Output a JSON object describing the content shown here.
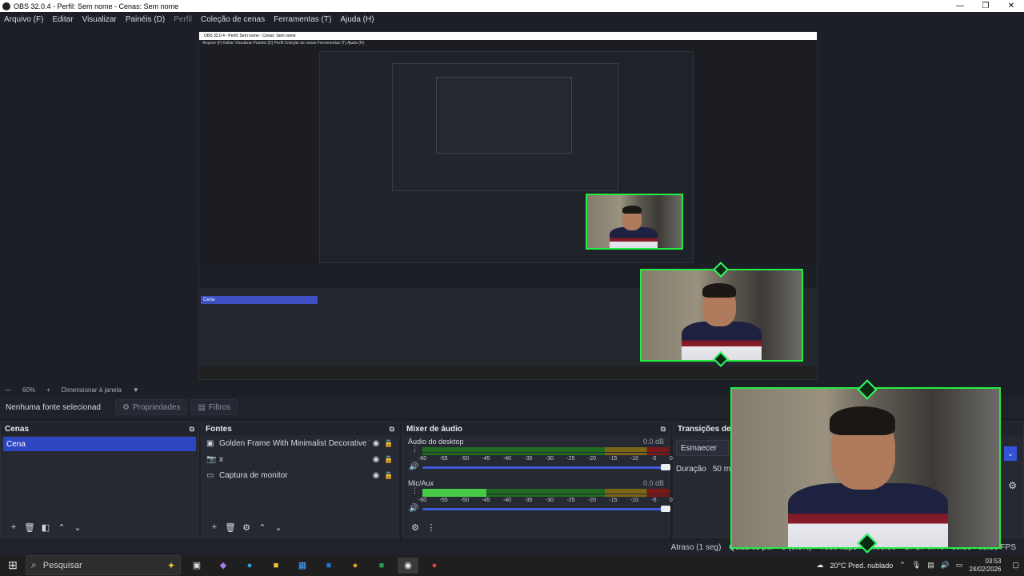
{
  "window": {
    "title": "OBS 32.0.4 - Perfil: Sem nome - Cenas: Sem nome",
    "min": "—",
    "max": "❐",
    "close": "✕"
  },
  "menu": [
    "Arquivo (F)",
    "Editar",
    "Visualizar",
    "Painéis (D)",
    "Perfil",
    "Coleção de cenas",
    "Ferramentas (T)",
    "Ajuda (H)"
  ],
  "status_row": {
    "minus": "—",
    "zoom": "60%",
    "plus": "+",
    "resize": "Dimensionar à janela",
    "caret": "▼"
  },
  "props": {
    "no_source": "Nenhuma fonte selecionad",
    "properties": "Propriedades",
    "filters": "Filtros"
  },
  "scenes": {
    "title": "Cenas",
    "items": [
      "Cena"
    ]
  },
  "sources": {
    "title": "Fontes",
    "items": [
      {
        "icon": "image-icon",
        "name": "Golden Frame With Minimalist Decorative Vinta"
      },
      {
        "icon": "camera-icon",
        "name": "x"
      },
      {
        "icon": "monitor-icon",
        "name": "Captura de monitor"
      }
    ]
  },
  "mixer": {
    "title": "Mixer de áudio",
    "channels": [
      {
        "name": "Áudio do desktop",
        "db": "0.0 dB",
        "level": 0
      },
      {
        "name": "Mic/Aux",
        "db": "0.0 dB",
        "level": 0.26
      }
    ],
    "ticks": [
      "-60",
      "-55",
      "-50",
      "-45",
      "-40",
      "-35",
      "-30",
      "-25",
      "-20",
      "-15",
      "-10",
      "-5",
      "0"
    ]
  },
  "transitions": {
    "title": "Transições de c",
    "selected": "Esmaecer",
    "duration_label": "Duração",
    "duration_value": "50 ms"
  },
  "bottom_status": {
    "delay": "Atraso (1 seg)",
    "frames": "Quadros per",
    "dropped": "0 (0.0%)",
    "kbps": "7980 kbps",
    "rec_time": "00:00:00",
    "cpu": "CPU: 4.7%",
    "fps": "60.00 / 60.00 FPS"
  },
  "taskbar": {
    "search_placeholder": "Pesquisar",
    "weather": "20°C  Pred. nublado",
    "time": "03:53",
    "date": "24/02/2026"
  },
  "nested_preview": {
    "title": "OBS 32.0.4 - Perfil: Sem nome - Cenas: Sem nome",
    "menu": "Arquivo (F)   Editar   Visualizar   Painéis (D)   Perfil   Coleção de cenas   Ferramentas (T)   Ajuda (H)",
    "scene": "Cena"
  }
}
